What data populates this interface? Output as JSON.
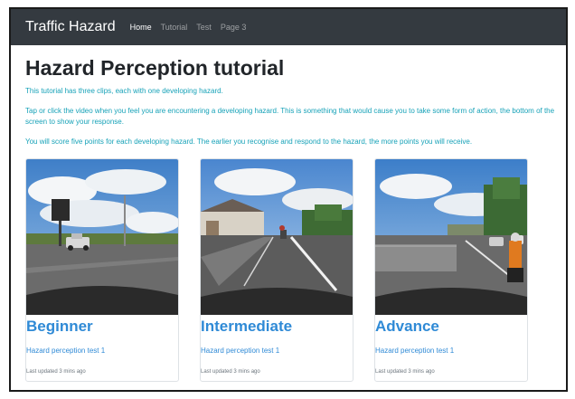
{
  "navbar": {
    "brand": "Traffic Hazard",
    "links": [
      {
        "label": "Home",
        "active": true
      },
      {
        "label": "Tutorial",
        "active": false
      },
      {
        "label": "Test",
        "active": false
      },
      {
        "label": "Page 3",
        "active": false
      }
    ]
  },
  "main": {
    "title": "Hazard Perception tutorial",
    "paragraphs": [
      "This tutorial has three clips, each with one developing hazard.",
      "Tap or click the video when you feel you are encountering a developing hazard. This is something that would cause you to take some form of action, the bottom of the screen to show your response.",
      "You will score five points for each developing hazard. The earlier you recognise and respond to the hazard, the more points you will receive."
    ]
  },
  "cards": [
    {
      "title": "Beginner",
      "text": "Hazard perception test 1",
      "meta": "Last updated 3 mins ago"
    },
    {
      "title": "Intermediate",
      "text": "Hazard perception test 1",
      "meta": "Last updated 3 mins ago"
    },
    {
      "title": "Advance",
      "text": "Hazard perception test 1",
      "meta": "Last updated 3 mins ago"
    }
  ],
  "colors": {
    "navbar_bg": "#343a40",
    "intro_text": "#17a2b8",
    "card_title": "#2f8ad6"
  }
}
